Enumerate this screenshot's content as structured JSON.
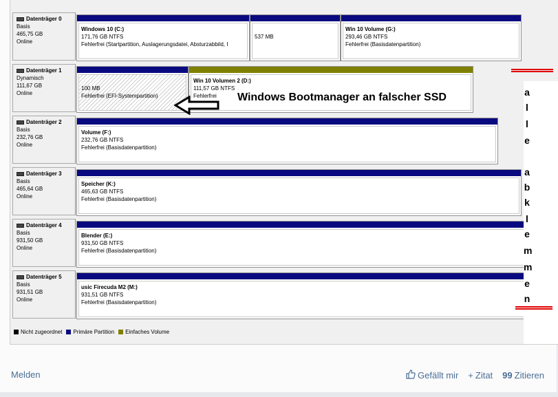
{
  "disks": [
    {
      "name": "Datenträger 0",
      "type": "Basis",
      "size": "465,75 GB",
      "status": "Online",
      "partitions": [
        {
          "name": "Windows 10  (C:)",
          "size": "171,76 GB NTFS",
          "status": "Fehlerfrei (Startpartition, Auslagerungsdatei, Absturzabbild, I",
          "kind": "primary"
        },
        {
          "name": "",
          "size": "537 MB",
          "status": "",
          "kind": "primary"
        },
        {
          "name": "Win 10 Volume  (G:)",
          "size": "293,46 GB NTFS",
          "status": "Fehlerfrei (Basisdatenpartition)",
          "kind": "primary"
        }
      ]
    },
    {
      "name": "Datenträger 1",
      "type": "Dynamisch",
      "size": "111,67 GB",
      "status": "Online",
      "partitions": [
        {
          "name": "",
          "size": "100 MB",
          "status": "Fehlerfrei (EFI-Systempartition)",
          "kind": "primary",
          "hatched": true
        },
        {
          "name": "Win 10 Volumen 2  (D:)",
          "size": "111,57 GB NTFS",
          "status": "Fehlerfrei",
          "kind": "simple"
        }
      ]
    },
    {
      "name": "Datenträger 2",
      "type": "Basis",
      "size": "232,76 GB",
      "status": "Online",
      "partitions": [
        {
          "name": "Volume  (F:)",
          "size": "232,76 GB NTFS",
          "status": "Fehlerfrei (Basisdatenpartition)",
          "kind": "primary"
        }
      ]
    },
    {
      "name": "Datenträger 3",
      "type": "Basis",
      "size": "465,64 GB",
      "status": "Online",
      "partitions": [
        {
          "name": "Speicher  (K:)",
          "size": "465,63 GB NTFS",
          "status": "Fehlerfrei (Basisdatenpartition)",
          "kind": "primary"
        }
      ]
    },
    {
      "name": "Datenträger 4",
      "type": "Basis",
      "size": "931,50 GB",
      "status": "Online",
      "partitions": [
        {
          "name": "Blender  (E:)",
          "size": "931,50 GB NTFS",
          "status": "Fehlerfrei (Basisdatenpartition)",
          "kind": "primary"
        }
      ]
    },
    {
      "name": "Datenträger 5",
      "type": "Basis",
      "size": "931,51 GB",
      "status": "Online",
      "partitions": [
        {
          "name": "usic Firecuda M2  (M:)",
          "size": "931,51 GB NTFS",
          "status": "Fehlerfrei (Basisdatenpartition)",
          "kind": "primary"
        }
      ]
    }
  ],
  "legend": {
    "unallocated": "Nicht zugeordnet",
    "primary": "Primäre Partition",
    "simple": "Einfaches Volume"
  },
  "annotation": {
    "text": "Windows Bootmanager an falscher SSD",
    "vertical_letters": [
      "a",
      "l",
      "l",
      "e",
      "",
      "a",
      "b",
      "k",
      "l",
      "e",
      "m",
      "m",
      "e",
      "n"
    ]
  },
  "footer": {
    "report": "Melden",
    "like": "Gefällt mir",
    "quote": "Zitat",
    "cite": "Zitieren"
  },
  "colors": {
    "primary": "#0a0a80",
    "simple": "#808000",
    "unallocated": "#000000",
    "annotation_red": "#e00000",
    "link": "#4a6e93"
  }
}
